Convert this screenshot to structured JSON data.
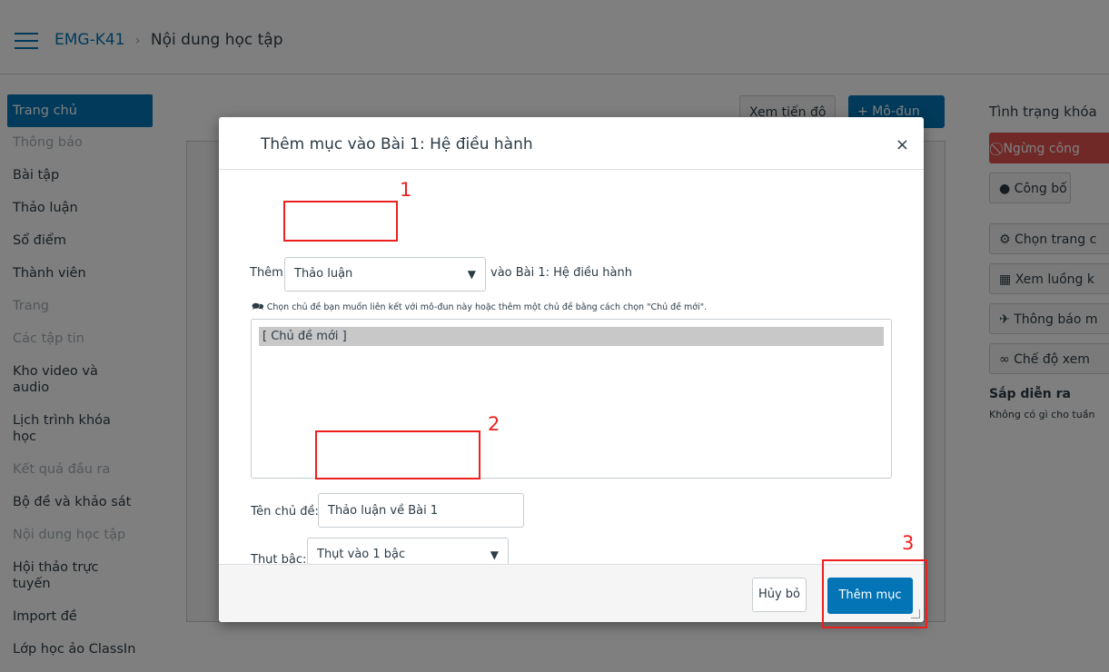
{
  "header": {
    "course": "EMG-K41",
    "separator": "›",
    "page": "Nội dung học tập"
  },
  "sidebar": {
    "items": [
      {
        "label": "Trang chủ"
      },
      {
        "label": "Thông báo"
      },
      {
        "label": "Bài tập"
      },
      {
        "label": "Thảo luận"
      },
      {
        "label": "Sổ điểm"
      },
      {
        "label": "Thành viên"
      },
      {
        "label": "Trang"
      },
      {
        "label": "Các tập tin"
      },
      {
        "label": "Kho video và audio"
      },
      {
        "label": "Lịch trình khóa học"
      },
      {
        "label": "Kết quả đầu ra"
      },
      {
        "label": "Bộ đề và khảo sát"
      },
      {
        "label": "Nội dung học tập"
      },
      {
        "label": "Hội thảo trực tuyến"
      },
      {
        "label": "Import đề"
      },
      {
        "label": "Lớp học ảo ClassIn"
      }
    ]
  },
  "toolbar": {
    "progress_label": "Xem tiến độ",
    "module_label": "+ Mô-đun"
  },
  "right_panel": {
    "status_title": "Tình trạng khóa",
    "unpublish_label": "⃠ Ngừng công",
    "publish_label": "Công bố",
    "choose_home_label": "Chọn trang c",
    "stream_label": "Xem luồng k",
    "announce_label": "Thông báo m",
    "view_mode_label": "Chế độ xem",
    "upcoming_title": "Sắp diễn ra",
    "upcoming_empty": "Không có gì cho tuần"
  },
  "dialog": {
    "title": "Thêm mục vào Bài 1: Hệ điều hành",
    "close_symbol": "×",
    "add_label": "Thêm",
    "type_value": "Thảo luận",
    "into_label": "vào Bài 1: Hệ điều hành",
    "hint": "Chọn chủ đề bạn muốn liên kết với mô-đun này hoặc thêm một chủ đề bằng cách chọn \"Chủ đề mới\".",
    "list_option": "[ Chủ đề mới ]",
    "topic_name_label": "Tên chủ đề:",
    "topic_name_value": "Thảo luận về Bài 1",
    "indent_label": "Thụt bậc:",
    "indent_value": "Thụt vào 1 bậc",
    "cancel_label": "Hủy bỏ",
    "submit_label": "Thêm mục"
  },
  "annotations": {
    "n1": "1",
    "n2": "2",
    "n3": "3",
    "color": "#ee1f1f"
  },
  "colors": {
    "primary": "#0374b5",
    "danger": "#e0534f"
  }
}
